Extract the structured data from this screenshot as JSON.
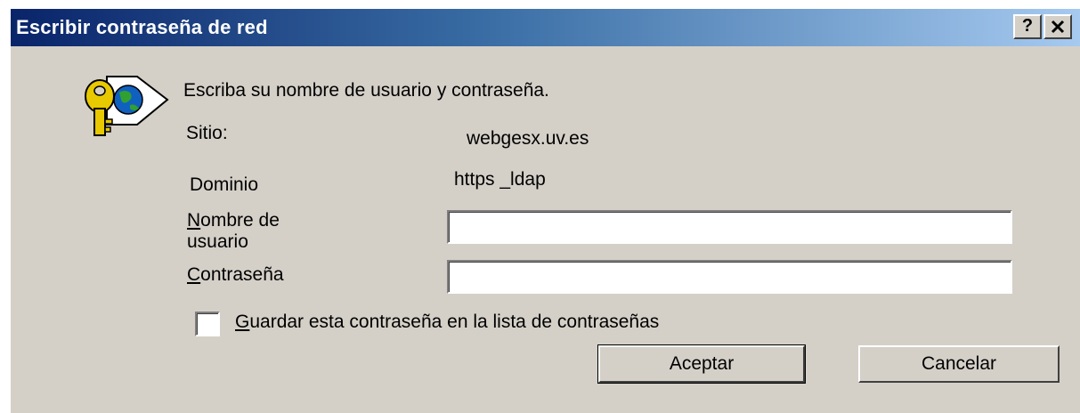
{
  "window": {
    "title": "Escribir contraseña de red",
    "help_button": "?",
    "close_button": "×"
  },
  "icon": "key-globe-icon",
  "prompt": "Escriba su nombre de usuario y contraseña.",
  "site": {
    "label": "Sitio:",
    "value": "webgesx.uv.es"
  },
  "domain": {
    "label": "Dominio",
    "value": "https _ldap"
  },
  "username": {
    "label_first": "N",
    "label_rest": "ombre de",
    "label_line2": "usuario",
    "value": ""
  },
  "password": {
    "label_first": "C",
    "label_rest": "ontraseña",
    "value": ""
  },
  "save_password": {
    "label_first": "G",
    "label_rest": "uardar esta contraseña en la lista de contraseñas",
    "checked": false
  },
  "buttons": {
    "ok": "Aceptar",
    "cancel": "Cancelar"
  },
  "colors": {
    "titlebar_start": "#0a246a",
    "titlebar_end": "#a6caf0",
    "dialog_bg": "#d4d0c8",
    "key_gold": "#e8c800",
    "globe_blue": "#1060c0",
    "globe_green": "#30a030"
  }
}
